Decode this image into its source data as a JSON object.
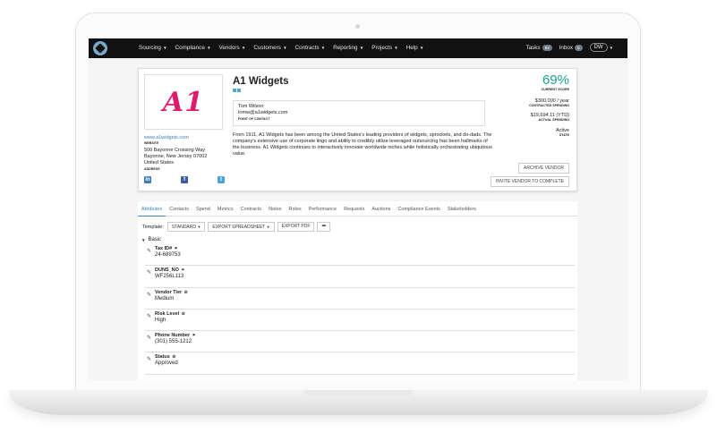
{
  "nav": {
    "menu": [
      {
        "label": "Sourcing"
      },
      {
        "label": "Compliance"
      },
      {
        "label": "Vendors"
      },
      {
        "label": "Customers"
      },
      {
        "label": "Contracts"
      },
      {
        "label": "Reporting"
      },
      {
        "label": "Projects"
      },
      {
        "label": "Help"
      }
    ],
    "tasks_label": "Tasks",
    "tasks_count": "83",
    "inbox_label": "Inbox",
    "inbox_count": "0",
    "user_initials": "DW"
  },
  "vendor": {
    "logo_text": "A1",
    "name": "A1 Widgets",
    "website": "www.a1widgets.com",
    "website_label": "WEBSITE",
    "address_line1": "500 Bayonne Crossing Way",
    "address_line2": "Bayonne, New Jersey 07002",
    "address_line3": "United States",
    "address_label": "ADDRESS",
    "contact_name": "Tom Wilson",
    "contact_email": "tomw@a1widgets.com",
    "contact_label": "POINT OF CONTACT",
    "description": "From 1911, A1 Widgets has been among the United States's leading providers of widgets, sprockets, and do-dads. The company's extensive use of corporate lingo and ability to credibly utilize leveraged outsourcing has been hallmarks of the business. A1 Widgets continues to interactively innovate worldwide niches while holistically orchestrating ubiquitous value.",
    "score": "69%",
    "score_label": "CURRENT SCORE",
    "contracted_spending": "$300,000 / year",
    "contracted_label": "CONTRACTED SPENDING",
    "actual_spending": "$19,694.11 (YTD)",
    "actual_label": "ACTUAL SPENDING",
    "state": "Active",
    "state_label": "STATE",
    "archive_button": "ARCHIVE VENDOR",
    "invite_button": "INVITE VENDOR TO COMPLETE",
    "social_icons": [
      "linkedin-icon",
      "facebook-icon",
      "twitter-icon"
    ]
  },
  "tabs": [
    {
      "label": "Attributes",
      "active": true
    },
    {
      "label": "Contacts"
    },
    {
      "label": "Spend"
    },
    {
      "label": "Metrics"
    },
    {
      "label": "Contracts"
    },
    {
      "label": "Notes"
    },
    {
      "label": "Roles"
    },
    {
      "label": "Performance"
    },
    {
      "label": "Requests"
    },
    {
      "label": "Auctions"
    },
    {
      "label": "Compliance Events"
    },
    {
      "label": "Stakeholders"
    }
  ],
  "toolbar": {
    "template_label": "Template:",
    "template_value": "STANDARD",
    "export_spreadsheet": "EXPORT SPREADSHEET",
    "export_pdf": "EXPORT PDF"
  },
  "section": {
    "title": "Basic"
  },
  "attributes": [
    {
      "name": "Tax ID#",
      "value": "24-689753",
      "icon": "link-icon"
    },
    {
      "name": "DUNS_NO",
      "value": "WF256L113",
      "icon": "link-icon"
    },
    {
      "name": "Vendor Tier",
      "value": "Medium",
      "icon": "hidden-icon"
    },
    {
      "name": "Risk Level",
      "value": "High",
      "icon": "hidden-icon"
    },
    {
      "name": "Phone Number",
      "value": "(301) 555-1212",
      "icon": "link-icon"
    },
    {
      "name": "Status",
      "value": "Approved",
      "icon": "hidden-icon"
    }
  ],
  "colors": {
    "accent": "#3b7fc4",
    "score": "#1aa38a",
    "logo": "#e0196b",
    "navbar": "#111111"
  }
}
